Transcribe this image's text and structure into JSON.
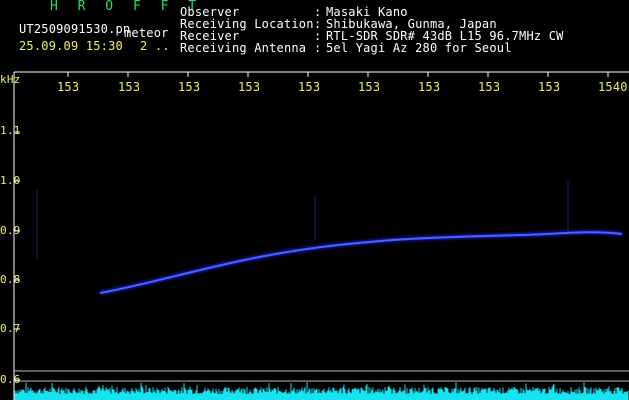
{
  "header": {
    "program": "H R O F F T",
    "filename": "UT2509091530.pn",
    "tag": "meteor",
    "datetime": "25.09.09 15:30",
    "count": "2 ..",
    "info": [
      {
        "label": "Observer",
        "value": "Masaki Kano"
      },
      {
        "label": "Receiving Location",
        "value": "Shibukawa, Gunma, Japan"
      },
      {
        "label": "Receiver",
        "value": "RTL-SDR SDR# 43dB L15 96.7MHz CW"
      },
      {
        "label": "Receiving Antenna",
        "value": "5el Yagi Az 280 for Seoul"
      }
    ],
    "colon": ":"
  },
  "plot": {
    "y_unit": "kHz",
    "y_ticks": [
      "1.1",
      "1.0",
      "0.9",
      "0.8",
      "0.7",
      "0.6"
    ],
    "x_ticks": [
      "153",
      "153",
      "153",
      "153",
      "153",
      "153",
      "153",
      "153",
      "153",
      "1540"
    ],
    "colors": {
      "axis": "#ffffff",
      "echo": "#3b4cff",
      "noise": "#17e3f0",
      "grid_line": "#cfcfcf"
    }
  }
}
